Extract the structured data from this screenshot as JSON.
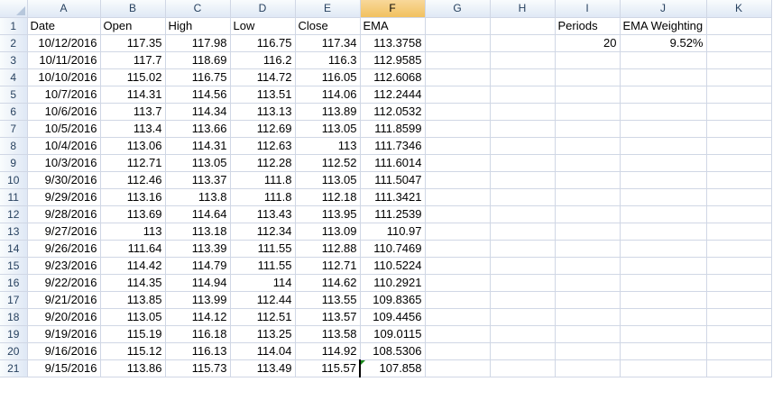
{
  "columns": [
    "A",
    "B",
    "C",
    "D",
    "E",
    "F",
    "G",
    "H",
    "I",
    "J",
    "K"
  ],
  "selected_column": "F",
  "selected_cell": "F21",
  "headers": {
    "A": "Date",
    "B": "Open",
    "C": "High",
    "D": "Low",
    "E": "Close",
    "F": "EMA",
    "I": "Periods",
    "J": "EMA Weighting"
  },
  "params": {
    "periods": "20",
    "ema_weighting": "9.52%"
  },
  "rows": [
    {
      "date": "10/12/2016",
      "open": "117.35",
      "high": "117.98",
      "low": "116.75",
      "close": "117.34",
      "ema": "113.3758"
    },
    {
      "date": "10/11/2016",
      "open": "117.7",
      "high": "118.69",
      "low": "116.2",
      "close": "116.3",
      "ema": "112.9585"
    },
    {
      "date": "10/10/2016",
      "open": "115.02",
      "high": "116.75",
      "low": "114.72",
      "close": "116.05",
      "ema": "112.6068"
    },
    {
      "date": "10/7/2016",
      "open": "114.31",
      "high": "114.56",
      "low": "113.51",
      "close": "114.06",
      "ema": "112.2444"
    },
    {
      "date": "10/6/2016",
      "open": "113.7",
      "high": "114.34",
      "low": "113.13",
      "close": "113.89",
      "ema": "112.0532"
    },
    {
      "date": "10/5/2016",
      "open": "113.4",
      "high": "113.66",
      "low": "112.69",
      "close": "113.05",
      "ema": "111.8599"
    },
    {
      "date": "10/4/2016",
      "open": "113.06",
      "high": "114.31",
      "low": "112.63",
      "close": "113",
      "ema": "111.7346"
    },
    {
      "date": "10/3/2016",
      "open": "112.71",
      "high": "113.05",
      "low": "112.28",
      "close": "112.52",
      "ema": "111.6014"
    },
    {
      "date": "9/30/2016",
      "open": "112.46",
      "high": "113.37",
      "low": "111.8",
      "close": "113.05",
      "ema": "111.5047"
    },
    {
      "date": "9/29/2016",
      "open": "113.16",
      "high": "113.8",
      "low": "111.8",
      "close": "112.18",
      "ema": "111.3421"
    },
    {
      "date": "9/28/2016",
      "open": "113.69",
      "high": "114.64",
      "low": "113.43",
      "close": "113.95",
      "ema": "111.2539"
    },
    {
      "date": "9/27/2016",
      "open": "113",
      "high": "113.18",
      "low": "112.34",
      "close": "113.09",
      "ema": "110.97"
    },
    {
      "date": "9/26/2016",
      "open": "111.64",
      "high": "113.39",
      "low": "111.55",
      "close": "112.88",
      "ema": "110.7469"
    },
    {
      "date": "9/23/2016",
      "open": "114.42",
      "high": "114.79",
      "low": "111.55",
      "close": "112.71",
      "ema": "110.5224"
    },
    {
      "date": "9/22/2016",
      "open": "114.35",
      "high": "114.94",
      "low": "114",
      "close": "114.62",
      "ema": "110.2921"
    },
    {
      "date": "9/21/2016",
      "open": "113.85",
      "high": "113.99",
      "low": "112.44",
      "close": "113.55",
      "ema": "109.8365"
    },
    {
      "date": "9/20/2016",
      "open": "113.05",
      "high": "114.12",
      "low": "112.51",
      "close": "113.57",
      "ema": "109.4456"
    },
    {
      "date": "9/19/2016",
      "open": "115.19",
      "high": "116.18",
      "low": "113.25",
      "close": "113.58",
      "ema": "109.0115"
    },
    {
      "date": "9/16/2016",
      "open": "115.12",
      "high": "116.13",
      "low": "114.04",
      "close": "114.92",
      "ema": "108.5306"
    },
    {
      "date": "9/15/2016",
      "open": "113.86",
      "high": "115.73",
      "low": "113.49",
      "close": "115.57",
      "ema": "107.858"
    }
  ],
  "colors": {
    "header_bg": "#dfe8f5",
    "selected_header_bg": "#f1c15f",
    "gridline": "#d0d7e5"
  }
}
